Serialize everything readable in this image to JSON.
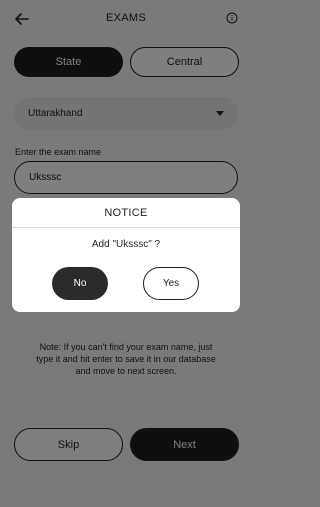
{
  "header": {
    "title": "EXAMS",
    "back_icon": "back-arrow-icon",
    "info_icon": "info-icon"
  },
  "toggle": {
    "state_label": "State",
    "central_label": "Central",
    "selected": "State"
  },
  "state_select": {
    "value": "Uttarakhand"
  },
  "exam_name": {
    "label": "Enter the exam name",
    "value": "Uksssc"
  },
  "note": "Note: If you can't find your exam name, just type it and hit enter to save it in our database and move to next screen.",
  "footer": {
    "skip_label": "Skip",
    "next_label": "Next"
  },
  "dialog": {
    "title": "NOTICE",
    "message": "Add \"Uksssc\" ?",
    "no_label": "No",
    "yes_label": "Yes"
  }
}
